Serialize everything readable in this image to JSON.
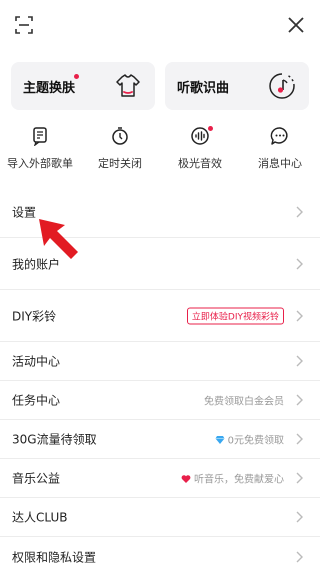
{
  "header": {
    "scan_icon": "scan-icon",
    "close_icon": "close-icon"
  },
  "cards": [
    {
      "label": "主题换肤",
      "icon": "tshirt-icon",
      "has_dot": true
    },
    {
      "label": "听歌识曲",
      "icon": "music-recognition-icon",
      "has_dot": false
    }
  ],
  "quick_actions": [
    {
      "label": "导入外部歌单",
      "icon": "import-playlist-icon"
    },
    {
      "label": "定时关闭",
      "icon": "timer-icon"
    },
    {
      "label": "极光音效",
      "icon": "sound-effect-icon",
      "has_dot": true
    },
    {
      "label": "消息中心",
      "icon": "message-icon"
    }
  ],
  "menu": [
    {
      "label": "设置"
    },
    {
      "label": "我的账户"
    },
    {
      "label": "DIY彩铃",
      "badge": "立即体验DIY视频彩铃"
    },
    {
      "label": "活动中心"
    },
    {
      "label": "任务中心",
      "hint": "免费领取白金会员"
    },
    {
      "label": "30G流量待领取",
      "hint": "0元免费领取",
      "hint_icon": "diamond-icon"
    },
    {
      "label": "音乐公益",
      "hint": "听音乐，免费献爱心",
      "hint_icon": "heart-icon"
    },
    {
      "label": "达人CLUB"
    },
    {
      "label": "权限和隐私设置"
    }
  ],
  "colors": {
    "accent": "#e8204a",
    "card_bg": "#f3f3f5",
    "arrow": "#e21b23"
  }
}
